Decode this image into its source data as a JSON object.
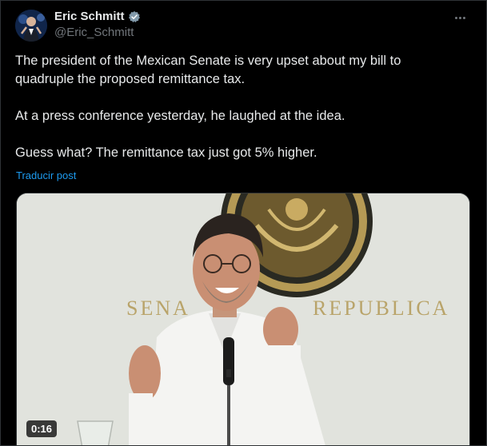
{
  "author": {
    "display_name": "Eric Schmitt",
    "handle": "@Eric_Schmitt",
    "verified_icon": "verified-badge-icon"
  },
  "tweet": {
    "paragraphs": [
      "The president of the Mexican Senate is very upset about my bill to quadruple the proposed remittance tax.",
      "At a press conference yesterday, he laughed at the idea.",
      "Guess what? The remittance tax just got 5% higher."
    ],
    "translate_label": "Traducir post"
  },
  "media": {
    "wall_text_left": "SENA",
    "wall_text_right": "REPUBLICA",
    "duration": "0:16"
  },
  "colors": {
    "background": "#000000",
    "text": "#e7e9ea",
    "secondary": "#71767b",
    "link": "#1d9bf0",
    "verified": "#829aab"
  }
}
